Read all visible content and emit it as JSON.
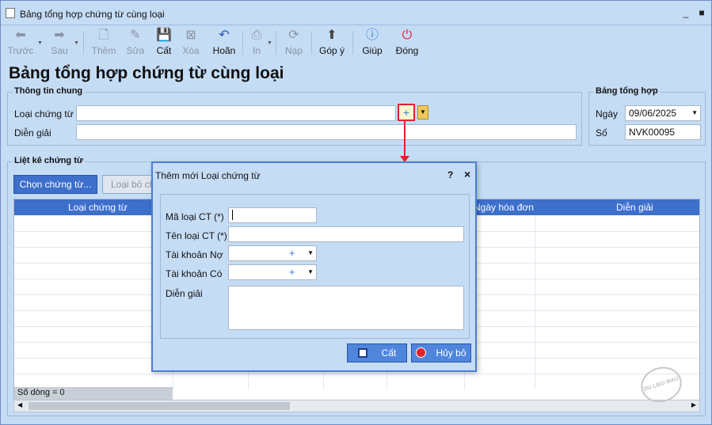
{
  "window": {
    "title": "Bảng tổng hợp chứng từ cùng loại"
  },
  "toolbar": {
    "prev": "Trước",
    "next": "Sau",
    "add": "Thêm",
    "edit": "Sửa",
    "save": "Cất",
    "delete": "Xóa",
    "undo": "Hoãn",
    "print": "In",
    "load": "Nạp",
    "feedback": "Góp ý",
    "help": "Giúp",
    "close": "Đóng"
  },
  "page_title": "Bảng tổng hợp chứng từ cùng loại",
  "general_info": {
    "title": "Thông tin chung",
    "doc_type_label": "Loại chứng từ",
    "doc_type_value": "",
    "description_label": "Diễn giải",
    "description_value": "",
    "plus": "+"
  },
  "summary": {
    "title": "Bảng tổng hợp",
    "date_label": "Ngày",
    "date_value": "09/06/2025",
    "number_label": "Số",
    "number_value": "NVK00095"
  },
  "list": {
    "title": "Liệt kê chứng từ",
    "choose_button": "Chọn chứng từ...",
    "remove_button": "Loại bỏ ch",
    "columns": [
      "Loại chứng từ",
      "Ngày hóa đơn",
      "Diễn giải"
    ],
    "row_count": "Số dòng = 0"
  },
  "dialog": {
    "title": "Thêm mới Loại chứng từ",
    "help": "?",
    "close": "×",
    "code_label": "Mã loại CT (*)",
    "name_label": "Tên loại CT (*)",
    "debit_label": "Tài khoản Nợ",
    "credit_label": "Tài khoản Có",
    "desc_label": "Diễn giải",
    "plus": "+",
    "save_button": "Cất",
    "cancel_button": "Hủy bỏ"
  },
  "watermark": "DU LIEU MAU",
  "colors": {
    "accent": "#3d6fcb",
    "highlight": "#e0232e",
    "background": "#c5dcf5"
  }
}
